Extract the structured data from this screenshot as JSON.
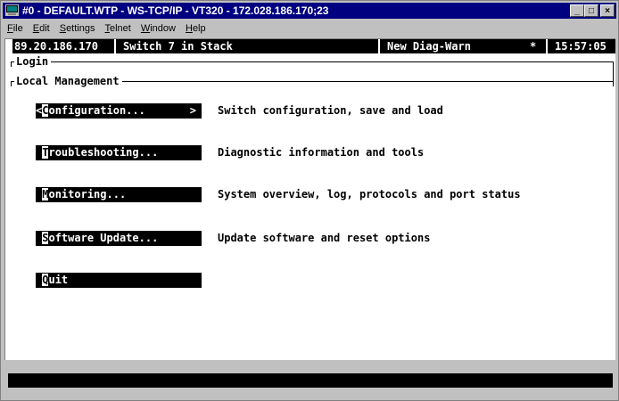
{
  "window": {
    "title": "#0 - DEFAULT.WTP - WS-TCP/IP - VT320 - 172.028.186.170;23",
    "buttons": {
      "minimize": "_",
      "maximize": "□",
      "close": "×"
    }
  },
  "menubar": [
    {
      "hot": "F",
      "rest": "ile"
    },
    {
      "hot": "E",
      "rest": "dit"
    },
    {
      "hot": "S",
      "rest": "ettings"
    },
    {
      "hot": "T",
      "rest": "elnet"
    },
    {
      "hot": "W",
      "rest": "indow"
    },
    {
      "hot": "H",
      "rest": "elp"
    }
  ],
  "terminal": {
    "status": {
      "ip": "89.20.186.170",
      "stack": "Switch 7 in Stack",
      "diag": "New Diag-Warn",
      "flag": "*",
      "time": "15:57:05"
    },
    "login_label": "Login",
    "group_label": "Local Management",
    "menu": [
      {
        "hot": "C",
        "pre": "<",
        "rest": "onfiguration...",
        "post": ">",
        "desc": "Switch configuration, save and load"
      },
      {
        "hot": "T",
        "pre": "",
        "rest": "roubleshooting...",
        "post": "",
        "desc": "Diagnostic information and tools"
      },
      {
        "hot": "M",
        "pre": "",
        "rest": "onitoring...",
        "post": "",
        "desc": "System overview, log, protocols and port status"
      },
      {
        "hot": "S",
        "pre": "",
        "rest": "oftware Update...",
        "post": "",
        "desc": "Update software and reset options"
      },
      {
        "hot": "Q",
        "pre": "",
        "rest": "uit",
        "post": "",
        "desc": ""
      }
    ]
  },
  "colors": {
    "titlebar": "#000080",
    "terminal_bg": "#ffffff",
    "inverse": "#000000"
  }
}
